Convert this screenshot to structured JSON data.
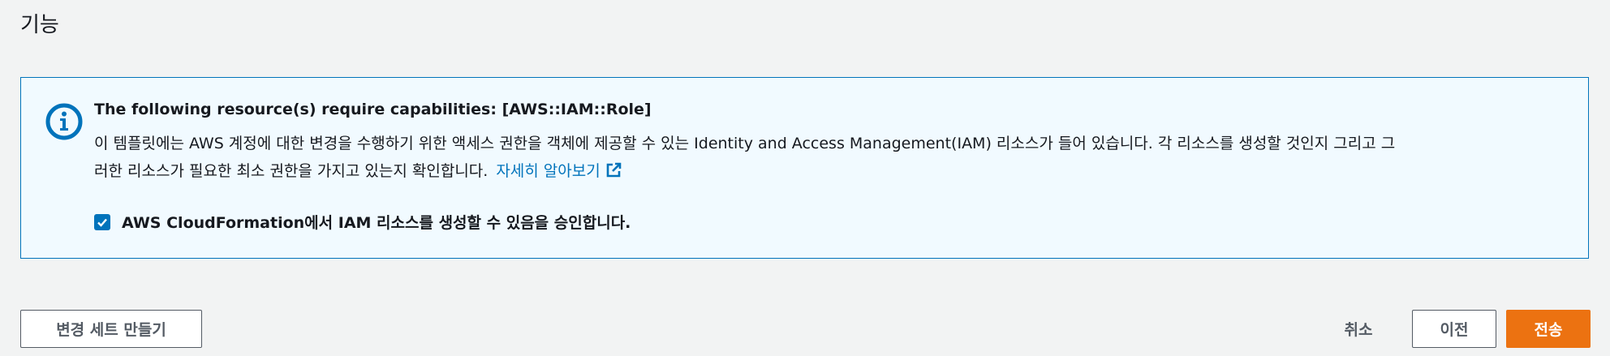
{
  "section": {
    "title": "기능"
  },
  "info": {
    "icon": "info-icon",
    "header": "The following resource(s) require capabilities: [AWS::IAM::Role]",
    "body_line1": "이 템플릿에는 AWS 계정에 대한 변경을 수행하기 위한 액세스 권한을 객체에 제공할 수 있는 Identity and Access Management(IAM) 리소스가 들어 있습니다. 각 리소스를 생성할 것인지 그리고 그",
    "body_line2": "러한 리소스가 필요한 최소 권한을 가지고 있는지 확인합니다.",
    "learn_more": "자세히 알아보기",
    "link_color": "#0073bb"
  },
  "acknowledge": {
    "checked": true,
    "label": "AWS CloudFormation에서 IAM 리소스를 생성할 수 있음을 승인합니다."
  },
  "footer": {
    "create_change_set": "변경 세트 만들기",
    "cancel": "취소",
    "previous": "이전",
    "submit": "전송",
    "primary_color": "#ec7211"
  }
}
